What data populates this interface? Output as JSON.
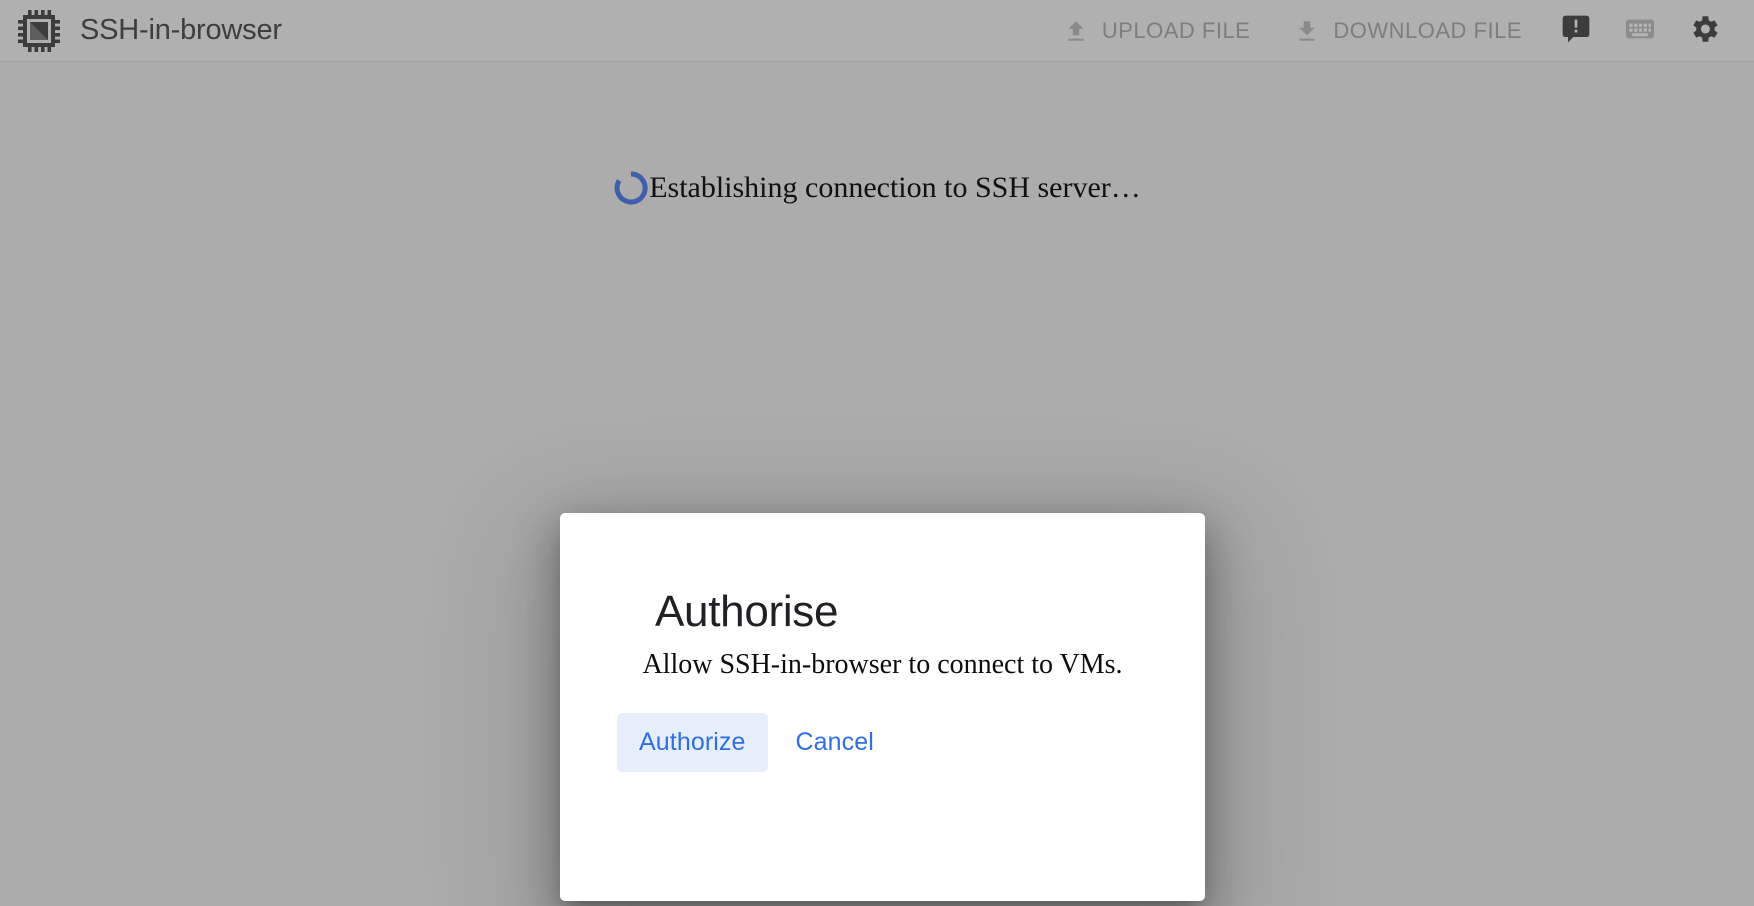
{
  "app": {
    "title": "SSH-in-browser",
    "logo_icon": "chip-icon"
  },
  "toolbar": {
    "upload": {
      "label": "UPLOAD FILE",
      "icon": "upload-arrow-icon"
    },
    "download": {
      "label": "DOWNLOAD FILE",
      "icon": "download-arrow-icon"
    },
    "icons": [
      {
        "name": "feedback-icon",
        "title": "Send feedback"
      },
      {
        "name": "keyboard-icon",
        "title": "Keyboard shortcuts"
      },
      {
        "name": "settings-gear-icon",
        "title": "Settings"
      }
    ]
  },
  "status": {
    "spinner_icon": "loading-spinner-icon",
    "message": "Establishing connection to SSH server…"
  },
  "dialog": {
    "title": "Authorise",
    "body": "Allow SSH-in-browser to connect to VMs.",
    "primary_button": "Authorize",
    "secondary_button": "Cancel"
  },
  "colors": {
    "page_background": "#acacac",
    "appbar_background": "#b0b0b0",
    "dialog_background": "#ffffff",
    "accent_blue": "#2f6ee4",
    "button_focus_background": "#e7eefb",
    "spinner_blue": "#3f5fad",
    "muted_text": "#7e7e7e",
    "icon_dark": "#3c3c3c"
  }
}
